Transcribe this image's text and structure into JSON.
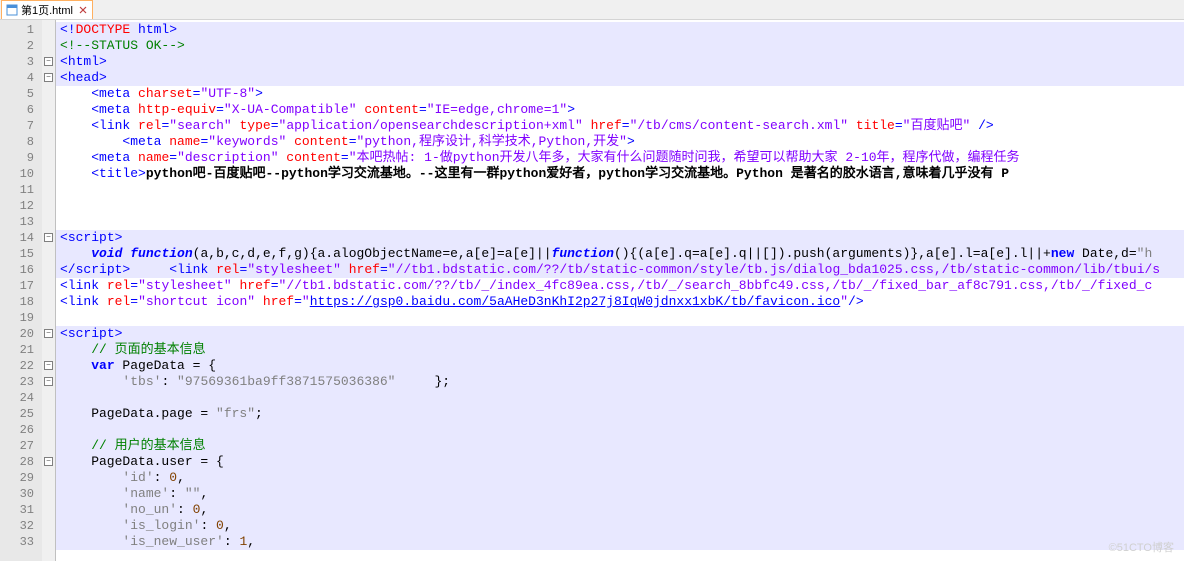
{
  "tab": {
    "label": "第1页.html",
    "close": "×"
  },
  "lineCount": 33,
  "fold": [
    {
      "line": 3,
      "sym": "-"
    },
    {
      "line": 4,
      "sym": "-"
    },
    {
      "line": 14,
      "sym": "-"
    },
    {
      "line": 20,
      "sym": "-"
    },
    {
      "line": 22,
      "sym": "-"
    },
    {
      "line": 23,
      "sym": "-"
    },
    {
      "line": 28,
      "sym": "-"
    }
  ],
  "code": {
    "l1": {
      "p": [
        "<!",
        "DOCTYPE",
        " html",
        ">"
      ],
      "c": [
        "t-blue",
        "t-red",
        "t-blue",
        "t-blue"
      ]
    },
    "l2": {
      "p": [
        "<!--STATUS OK-->"
      ],
      "c": [
        "t-green"
      ]
    },
    "l3": {
      "p": [
        "<",
        "html",
        ">"
      ],
      "c": [
        "t-blue",
        "t-blue",
        "t-blue"
      ]
    },
    "l4": {
      "p": [
        "<",
        "head",
        ">"
      ],
      "c": [
        "t-blue",
        "t-blue",
        "t-blue"
      ]
    },
    "l5": {
      "p": [
        "    ",
        "<",
        "meta",
        " charset",
        "=",
        "\"UTF-8\"",
        ">"
      ],
      "c": [
        "",
        "t-blue",
        "t-blue",
        "t-red",
        "t-blue",
        "t-purple",
        "t-blue"
      ]
    },
    "l6": {
      "p": [
        "    ",
        "<",
        "meta",
        " http-equiv",
        "=",
        "\"X-UA-Compatible\"",
        " content",
        "=",
        "\"IE=edge,chrome=1\"",
        ">"
      ],
      "c": [
        "",
        "t-blue",
        "t-blue",
        "t-red",
        "t-blue",
        "t-purple",
        "t-red",
        "t-blue",
        "t-purple",
        "t-blue"
      ]
    },
    "l7": {
      "p": [
        "    ",
        "<",
        "link",
        " rel",
        "=",
        "\"search\"",
        " type",
        "=",
        "\"application/opensearchdescription+xml\"",
        " href",
        "=",
        "\"/tb/cms/content-search.xml\"",
        " title",
        "=",
        "\"百度贴吧\"",
        " />"
      ],
      "c": [
        "",
        "t-blue",
        "t-blue",
        "t-red",
        "t-blue",
        "t-purple",
        "t-red",
        "t-blue",
        "t-purple",
        "t-red",
        "t-blue",
        "t-purple",
        "t-red",
        "t-blue",
        "t-purple",
        "t-blue"
      ]
    },
    "l8": {
      "p": [
        "        ",
        "<",
        "meta",
        " name",
        "=",
        "\"keywords\"",
        " content",
        "=",
        "\"python,程序设计,科学技术,Python,开发\"",
        ">"
      ],
      "c": [
        "",
        "t-blue",
        "t-blue",
        "t-red",
        "t-blue",
        "t-purple",
        "t-red",
        "t-blue",
        "t-purple",
        "t-blue"
      ]
    },
    "l9": {
      "p": [
        "    ",
        "<",
        "meta",
        " name",
        "=",
        "\"description\"",
        " content",
        "=",
        "\"本吧热帖: 1-做python开发八年多，大家有什么问题随时问我，希望可以帮助大家 2-10年，程序代做，编程任务"
      ],
      "c": [
        "",
        "t-blue",
        "t-blue",
        "t-red",
        "t-blue",
        "t-purple",
        "t-red",
        "t-blue",
        "t-purple"
      ]
    },
    "l10": {
      "p": [
        "    ",
        "<",
        "title",
        ">",
        "python吧-百度贴吧--python学习交流基地。--这里有一群python爱好者，python学习交流基地。Python 是著名的胶水语言,意味着几乎没有 P"
      ],
      "c": [
        "",
        "t-blue",
        "t-blue",
        "t-blue",
        "t-black t-bold"
      ]
    },
    "l11": {
      "p": [
        ""
      ],
      "c": [
        ""
      ]
    },
    "l12": {
      "p": [
        ""
      ],
      "c": [
        ""
      ]
    },
    "l13": {
      "p": [
        ""
      ],
      "c": [
        ""
      ]
    },
    "l14": {
      "p": [
        "<",
        "script",
        ">"
      ],
      "c": [
        "t-blue",
        "t-blue",
        "t-blue"
      ]
    },
    "l15": {
      "p": [
        "    ",
        "void",
        " ",
        "function",
        "(a,b,c,d,e,f,g){a.alogObjectName=e,a[e]=a[e]||",
        "function",
        "(){(a[e].q=a[e].q||[]).push(arguments)},a[e].l=a[e].l||",
        "+",
        "new",
        " Date,d=",
        "\"h"
      ],
      "c": [
        "",
        "t-blue t-ital t-bold",
        "",
        "t-blue t-ital t-bold",
        "t-black",
        "t-blue t-ital t-bold",
        "t-black",
        "t-black",
        "t-blue t-bold",
        "t-black",
        "t-grey"
      ]
    },
    "l16": {
      "p": [
        "</",
        "script",
        ">",
        "     ",
        "<",
        "link",
        " rel",
        "=",
        "\"stylesheet\"",
        " href",
        "=",
        "\"//tb1.bdstatic.com/??/tb/static-common/style/tb.js/dialog_bda1025.css,/tb/static-common/lib/tbui/s"
      ],
      "c": [
        "t-blue",
        "t-blue",
        "t-blue",
        "",
        "t-blue",
        "t-blue",
        "t-red",
        "t-blue",
        "t-purple",
        "t-red",
        "t-blue",
        "t-purple"
      ]
    },
    "l17": {
      "p": [
        "<",
        "link",
        " rel",
        "=",
        "\"stylesheet\"",
        " href",
        "=",
        "\"//tb1.bdstatic.com/??/tb/_/index_4fc89ea.css,/tb/_/search_8bbfc49.css,/tb/_/fixed_bar_af8c791.css,/tb/_/fixed_c"
      ],
      "c": [
        "t-blue",
        "t-blue",
        "t-red",
        "t-blue",
        "t-purple",
        "t-red",
        "t-blue",
        "t-purple"
      ]
    },
    "l18": {
      "p": [
        "<",
        "link",
        " rel",
        "=",
        "\"shortcut icon\"",
        " href",
        "=",
        "\"",
        "https://gsp0.baidu.com/5aAHeD3nKhI2p27j8IqW0jdnxx1xbK/tb/favicon.ico",
        "\"",
        "/>"
      ],
      "c": [
        "t-blue",
        "t-blue",
        "t-red",
        "t-blue",
        "t-purple",
        "t-red",
        "t-blue",
        "t-purple",
        "t-link",
        "t-purple",
        "t-blue"
      ]
    },
    "l19": {
      "p": [
        ""
      ],
      "c": [
        ""
      ]
    },
    "l20": {
      "p": [
        "<",
        "script",
        ">"
      ],
      "c": [
        "t-blue",
        "t-blue",
        "t-blue"
      ]
    },
    "l21": {
      "p": [
        "    ",
        "// 页面的基本信息"
      ],
      "c": [
        "",
        "t-green"
      ]
    },
    "l22": {
      "p": [
        "    ",
        "var",
        " PageData = {"
      ],
      "c": [
        "",
        "t-blue t-bold",
        "t-black"
      ]
    },
    "l23": {
      "p": [
        "        ",
        "'tbs'",
        ": ",
        "\"97569361ba9ff3871575036386\"",
        "     };"
      ],
      "c": [
        "",
        "t-grey",
        "t-black",
        "t-grey",
        "t-black"
      ]
    },
    "l24": {
      "p": [
        ""
      ],
      "c": [
        ""
      ]
    },
    "l25": {
      "p": [
        "    PageData.page = ",
        "\"frs\"",
        ";"
      ],
      "c": [
        "t-black",
        "t-grey",
        "t-black"
      ]
    },
    "l26": {
      "p": [
        ""
      ],
      "c": [
        ""
      ]
    },
    "l27": {
      "p": [
        "    ",
        "// 用户的基本信息"
      ],
      "c": [
        "",
        "t-green"
      ]
    },
    "l28": {
      "p": [
        "    PageData.user = {"
      ],
      "c": [
        "t-black"
      ]
    },
    "l29": {
      "p": [
        "        ",
        "'id'",
        ": ",
        "0",
        ","
      ],
      "c": [
        "",
        "t-grey",
        "t-black",
        "t-brown",
        "t-black"
      ]
    },
    "l30": {
      "p": [
        "        ",
        "'name'",
        ": ",
        "\"\"",
        ","
      ],
      "c": [
        "",
        "t-grey",
        "t-black",
        "t-grey",
        "t-black"
      ]
    },
    "l31": {
      "p": [
        "        ",
        "'no_un'",
        ": ",
        "0",
        ","
      ],
      "c": [
        "",
        "t-grey",
        "t-black",
        "t-brown",
        "t-black"
      ]
    },
    "l32": {
      "p": [
        "        ",
        "'is_login'",
        ": ",
        "0",
        ","
      ],
      "c": [
        "",
        "t-grey",
        "t-black",
        "t-brown",
        "t-black"
      ]
    },
    "l33": {
      "p": [
        "        ",
        "'is_new_user'",
        ": ",
        "1",
        ","
      ],
      "c": [
        "",
        "t-grey",
        "t-black",
        "t-brown",
        "t-black"
      ]
    }
  },
  "highlight": [
    1,
    2,
    3,
    4,
    14,
    15,
    16,
    20,
    21,
    22,
    23,
    24,
    25,
    26,
    27,
    28,
    29,
    30,
    31,
    32,
    33
  ],
  "watermark": "©51CTO博客"
}
